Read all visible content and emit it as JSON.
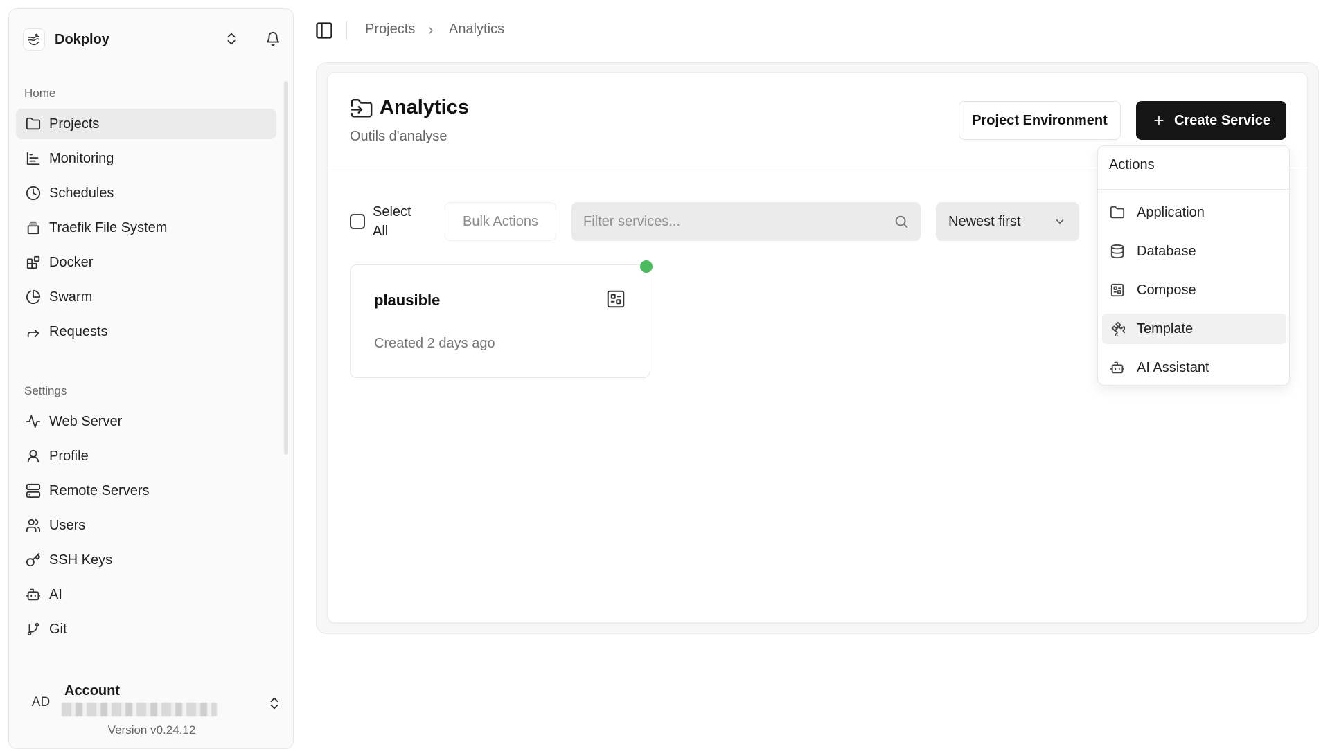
{
  "sidebar": {
    "team_name": "Dokploy",
    "home_label": "Home",
    "home_items": [
      {
        "label": "Projects",
        "icon": "folder-icon"
      },
      {
        "label": "Monitoring",
        "icon": "chart-icon"
      },
      {
        "label": "Schedules",
        "icon": "clock-icon"
      },
      {
        "label": "Traefik File System",
        "icon": "file-system-icon"
      },
      {
        "label": "Docker",
        "icon": "blocks-icon"
      },
      {
        "label": "Swarm",
        "icon": "pie-icon"
      },
      {
        "label": "Requests",
        "icon": "forward-arrow-icon"
      }
    ],
    "settings_label": "Settings",
    "settings_items": [
      {
        "label": "Web Server",
        "icon": "activity-icon"
      },
      {
        "label": "Profile",
        "icon": "user-icon"
      },
      {
        "label": "Remote Servers",
        "icon": "server-icon"
      },
      {
        "label": "Users",
        "icon": "users-icon"
      },
      {
        "label": "SSH Keys",
        "icon": "key-icon"
      },
      {
        "label": "AI",
        "icon": "bot-icon"
      },
      {
        "label": "Git",
        "icon": "git-branch-icon"
      }
    ],
    "account": {
      "initials": "AD",
      "title": "Account"
    },
    "version": "Version v0.24.12"
  },
  "breadcrumb": {
    "items": [
      "Projects",
      "Analytics"
    ]
  },
  "project": {
    "title": "Analytics",
    "description": "Outils d'analyse",
    "env_button": "Project Environment",
    "create_button": "Create Service"
  },
  "toolbar": {
    "select_all_label": "Select All",
    "bulk_actions_label": "Bulk Actions",
    "filter_placeholder": "Filter services...",
    "sort_value": "Newest first"
  },
  "services": [
    {
      "name": "plausible",
      "created": "Created 2 days ago",
      "status_color": "#4cbb5f"
    }
  ],
  "create_menu": {
    "label": "Actions",
    "items": [
      {
        "label": "Application",
        "icon": "folder-icon"
      },
      {
        "label": "Database",
        "icon": "database-icon"
      },
      {
        "label": "Compose",
        "icon": "compose-icon"
      },
      {
        "label": "Template",
        "icon": "puzzle-icon"
      },
      {
        "label": "AI Assistant",
        "icon": "bot-icon"
      }
    ]
  },
  "colors": {
    "primary_button": "#151515",
    "status_running": "#4cbb5f",
    "active_nav": "#ebebeb"
  }
}
